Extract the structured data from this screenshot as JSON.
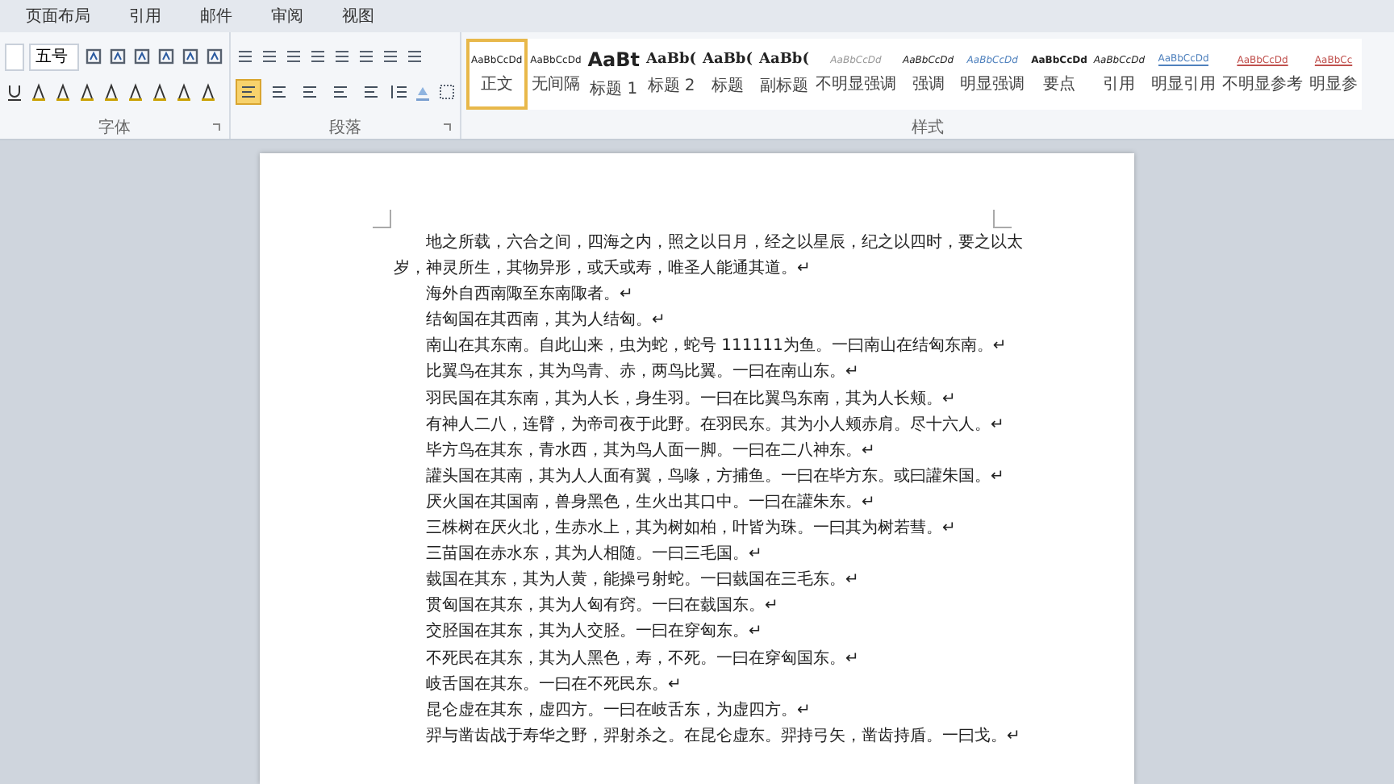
{
  "ribbon": {
    "tabs": [
      {
        "label": "页面布局",
        "selected": false
      },
      {
        "label": "引用",
        "selected": false
      },
      {
        "label": "邮件",
        "selected": false
      },
      {
        "label": "审阅",
        "selected": false
      },
      {
        "label": "视图",
        "selected": false
      }
    ],
    "font_group": {
      "label": "字体",
      "size": "五号"
    },
    "paragraph_group": {
      "label": "段落",
      "align_buttons": [
        {
          "selected": true
        },
        {
          "selected": false
        },
        {
          "selected": false
        },
        {
          "selected": false
        },
        {
          "selected": false
        }
      ]
    },
    "styles_group": {
      "label": "样式",
      "styles": [
        {
          "preview": "AaBbCcDd",
          "name": "正文",
          "kind": "normal",
          "selected": true
        },
        {
          "preview": "AaBbCcDd",
          "name": "无间隔",
          "kind": "normal",
          "selected": false
        },
        {
          "preview": "AaBt",
          "name": "标题 1",
          "kind": "heading1",
          "selected": false
        },
        {
          "preview": "AaBb(",
          "name": "标题 2",
          "kind": "heading",
          "selected": false
        },
        {
          "preview": "AaBb(",
          "name": "标题",
          "kind": "heading",
          "selected": false
        },
        {
          "preview": "AaBb(",
          "name": "副标题",
          "kind": "heading",
          "selected": false
        },
        {
          "preview": "AaBbCcDd",
          "name": "不明显强调",
          "kind": "subtle",
          "selected": false
        },
        {
          "preview": "AaBbCcDd",
          "name": "强调",
          "kind": "emphasis",
          "selected": false
        },
        {
          "preview": "AaBbCcDd",
          "name": "明显强调",
          "kind": "intense",
          "selected": false
        },
        {
          "preview": "AaBbCcDd",
          "name": "要点",
          "kind": "strong",
          "selected": false
        },
        {
          "preview": "AaBbCcDd",
          "name": "引用",
          "kind": "emphasis",
          "selected": false
        },
        {
          "preview": "AaBbCcDd",
          "name": "明显引用",
          "kind": "intense-quote",
          "selected": false
        },
        {
          "preview": "AaBbCcDd",
          "name": "不明显参考",
          "kind": "reference",
          "selected": false
        },
        {
          "preview": "AaBbCc",
          "name": "明显参",
          "kind": "reference",
          "selected": false
        }
      ]
    }
  },
  "document": {
    "paragraphs": [
      "地之所载，六合之间，四海之内，照之以日月，经之以星辰，纪之以四时，要之以太岁，神灵所生，其物异形，或夭或寿，唯圣人能通其道。↵",
      "海外自西南陬至东南陬者。↵",
      "结匈国在其西南，其为人结匈。↵",
      "南山在其东南。自此山来，虫为蛇，蛇号 111111为鱼。一曰南山在结匈东南。↵",
      "比翼鸟在其东，其为鸟青、赤，两鸟比翼。一曰在南山东。↵",
      "羽民国在其东南，其为人长，身生羽。一曰在比翼鸟东南，其为人长颊。↵",
      "有神人二八，连臂，为帝司夜于此野。在羽民东。其为小人颊赤肩。尽十六人。↵",
      "毕方鸟在其东，青水西，其为鸟人面一脚。一曰在二八神东。↵",
      "讙头国在其南，其为人人面有翼，鸟喙，方捕鱼。一曰在毕方东。或曰讙朱国。↵",
      "厌火国在其国南，兽身黑色，生火出其口中。一曰在讙朱东。↵",
      "三株树在厌火北，生赤水上，其为树如柏，叶皆为珠。一曰其为树若彗。↵",
      "三苗国在赤水东，其为人相随。一曰三毛国。↵",
      "臷国在其东，其为人黄，能操弓射蛇。一曰臷国在三毛东。↵",
      "贯匈国在其东，其为人匈有窍。一曰在臷国东。↵",
      "交胫国在其东，其为人交胫。一曰在穿匈东。↵",
      "不死民在其东，其为人黑色，寿，不死。一曰在穿匈国东。↵",
      "岐舌国在其东。一曰在不死民东。↵",
      "昆仑虚在其东，虚四方。一曰在岐舌东，为虚四方。↵",
      "羿与凿齿战于寿华之野，羿射杀之。在昆仑虚东。羿持弓矢，凿齿持盾。一曰戈。↵"
    ]
  }
}
